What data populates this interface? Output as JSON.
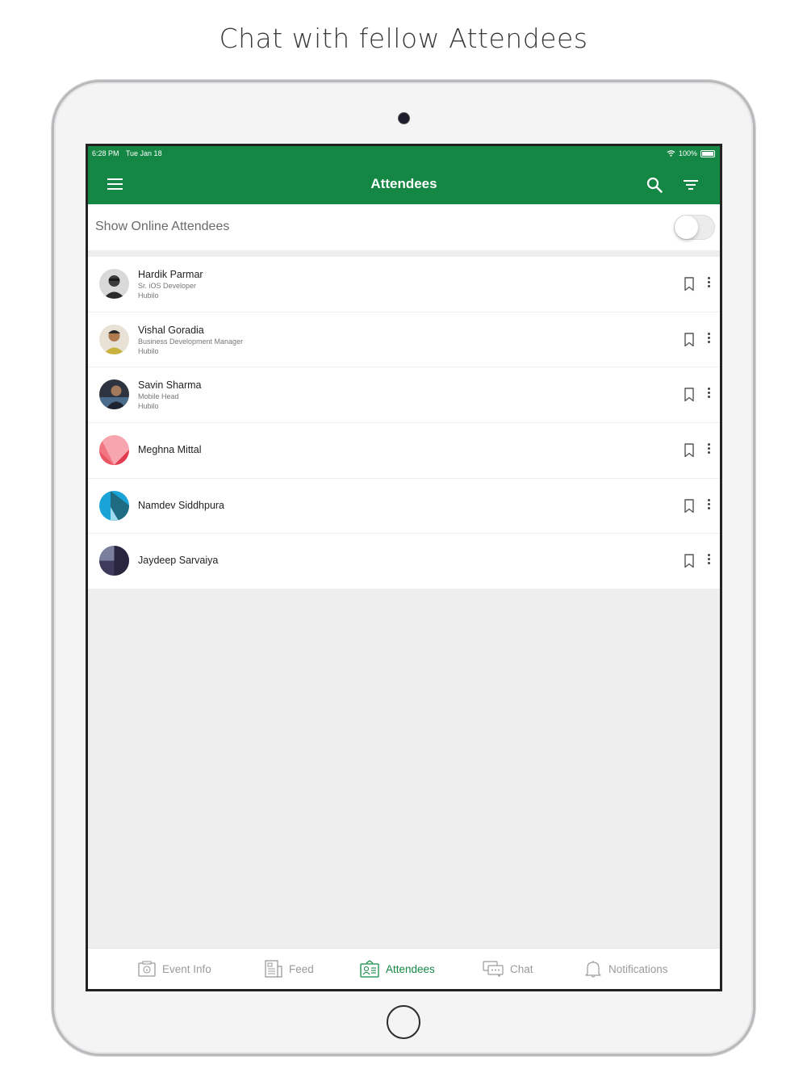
{
  "headline": "Chat with fellow Attendees",
  "status_bar": {
    "time": "6:28 PM",
    "date": "Tue Jan 18",
    "battery": "100%"
  },
  "app_bar": {
    "title": "Attendees",
    "left_icon": "menu-icon",
    "right_icons": [
      "search-icon",
      "filter-icon"
    ]
  },
  "online_filter": {
    "label": "Show Online Attendees",
    "enabled": false
  },
  "attendees": [
    {
      "name": "Hardik Parmar",
      "designation": "Sr. iOS Developer",
      "company": "Hubilo"
    },
    {
      "name": "Vishal Goradia",
      "designation": "Business Development Manager",
      "company": "Hubilo"
    },
    {
      "name": "Savin Sharma",
      "designation": "Mobile Head",
      "company": "Hubilo"
    },
    {
      "name": "Meghna Mittal"
    },
    {
      "name": "Namdev Siddhpura"
    },
    {
      "name": "Jaydeep Sarvaiya"
    }
  ],
  "tabs": [
    {
      "label": "Event Info",
      "icon": "event-info-icon"
    },
    {
      "label": "Feed",
      "icon": "feed-icon"
    },
    {
      "label": "Attendees",
      "icon": "attendees-icon",
      "active": true
    },
    {
      "label": "Chat",
      "icon": "chat-icon"
    },
    {
      "label": "Notifications",
      "icon": "bell-icon"
    }
  ],
  "colors": {
    "primary": "#158744",
    "inactive_tab": "#9a9a9a",
    "background": "#efeeee"
  }
}
